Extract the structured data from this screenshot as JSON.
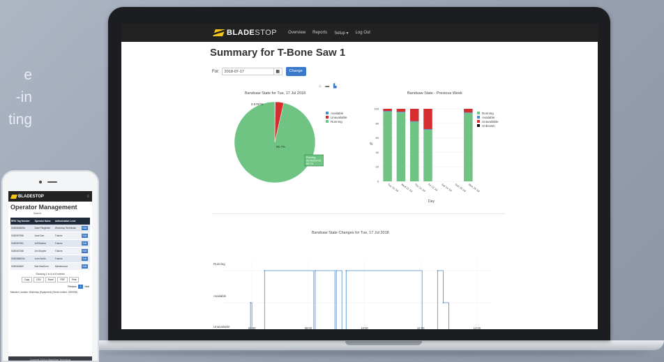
{
  "background_text": [
    "e",
    "-in",
    "ting"
  ],
  "app": {
    "brand_primary": "BLADE",
    "brand_secondary": "STOP",
    "nav_items": [
      "Overview",
      "Reports",
      "Setup ▾",
      "Log Out"
    ],
    "accent_color": "#3a79c9",
    "brand_color": "#f2c318"
  },
  "page": {
    "title": "Summary for T-Bone Saw 1",
    "for_label": "For:",
    "date_value": "2018-07-17",
    "change_label": "Change",
    "toolbar_icons": [
      "home-icon",
      "camera-icon",
      "chart-icon"
    ]
  },
  "chart_data": [
    {
      "type": "pie",
      "title": "Bandsaw State for Tue, 17 Jul 2018",
      "labels": [
        "Available",
        "Unavailable",
        "Running"
      ],
      "values": [
        0.16,
        3.4,
        96.44
      ],
      "colors": [
        "#4e8ccc",
        "#d62e2e",
        "#6fc483"
      ],
      "slice_label_top": "0.0767%",
      "slice_label_center": "95.7%",
      "tooltip": [
        "Running",
        "95.49303718",
        "95.7%"
      ],
      "legend": "right"
    },
    {
      "type": "bar",
      "stacked": true,
      "title": "Bandsaw State - Previous Week",
      "categories": [
        "Tue 10 Jul",
        "Wed 11 Jul",
        "Thu 12 Jul",
        "Fri 13 Jul",
        "Sat 14 Jul",
        "Sun 15 Jul",
        "Mon 16 Jul"
      ],
      "series": [
        {
          "name": "Running",
          "color": "#6fc483",
          "values": [
            96,
            95,
            82,
            71,
            0,
            0,
            94
          ]
        },
        {
          "name": "Available",
          "color": "#4e8ccc",
          "values": [
            1,
            1,
            1,
            1,
            0,
            0,
            1
          ]
        },
        {
          "name": "Unavailable",
          "color": "#d62e2e",
          "values": [
            3,
            4,
            17,
            28,
            0,
            0,
            5
          ]
        },
        {
          "name": "Unknown",
          "color": "#111111",
          "values": [
            0,
            0,
            0,
            0,
            0,
            0,
            0
          ]
        }
      ],
      "ylabel": "%",
      "xlabel": "Day",
      "yticks": [
        0,
        20,
        40,
        60,
        80,
        100
      ],
      "ylim": [
        0,
        100
      ],
      "legend": "right"
    },
    {
      "type": "line",
      "title": "Bandsaw State Changes for Tue, 17 Jul 2018",
      "y_categories": [
        "Unavailable",
        "Available",
        "Running"
      ],
      "x_ticks": [
        "06:00",
        "08:00",
        "10:00",
        "12:00",
        "14:00"
      ],
      "x_range": [
        5.5,
        14.5
      ],
      "transitions": [
        {
          "t": 5.5,
          "state": "Unavailable"
        },
        {
          "t": 5.95,
          "state": "Available"
        },
        {
          "t": 6.0,
          "state": "Unavailable"
        },
        {
          "t": 6.45,
          "state": "Running"
        },
        {
          "t": 8.2,
          "state": "Unavailable"
        },
        {
          "t": 8.25,
          "state": "Running"
        },
        {
          "t": 8.95,
          "state": "Unavailable"
        },
        {
          "t": 9.0,
          "state": "Running"
        },
        {
          "t": 9.2,
          "state": "Unavailable"
        },
        {
          "t": 9.35,
          "state": "Running"
        },
        {
          "t": 12.05,
          "state": "Unavailable"
        },
        {
          "t": 12.6,
          "state": "Running"
        },
        {
          "t": 12.8,
          "state": "Available"
        },
        {
          "t": 13.0,
          "state": "Unavailable"
        }
      ],
      "line_color": "#4e8ccc"
    }
  ],
  "phone": {
    "brand": "BLADESTOP",
    "title": "Operator Management",
    "search_label": "Search:",
    "columns": [
      "RFID Tag Number",
      "Operator Name",
      "Authorization Level",
      ""
    ],
    "rows": [
      [
        "0185361869A",
        "Dave Fitzgerald",
        "Workshop Technician",
        "Edit"
      ],
      [
        "0185367988",
        "Jane Doe",
        "Trainee",
        "Edit"
      ],
      [
        "0185367982",
        "Jeff Bullens",
        "Trainee",
        "Edit"
      ],
      [
        "0185367258",
        "Jim Smythe",
        "Trainee",
        "Edit"
      ],
      [
        "01853656004",
        "John Smith",
        "Trainee",
        "Edit"
      ],
      [
        "0185361869",
        "Burt MacEuen",
        "Maintenance",
        "Edit"
      ]
    ],
    "showing": "Showing 1 to 6 of 6 entries",
    "export_buttons": [
      "Copy",
      "CSV",
      "Excel",
      "PDF",
      "Print"
    ],
    "pager": [
      "Previous",
      "1",
      "Next"
    ],
    "machine_location": "Machine Location: Workshop (Equipment) (Serial number: 0000000)",
    "footer": "Copyright 2018 by BladeStop Technology"
  }
}
